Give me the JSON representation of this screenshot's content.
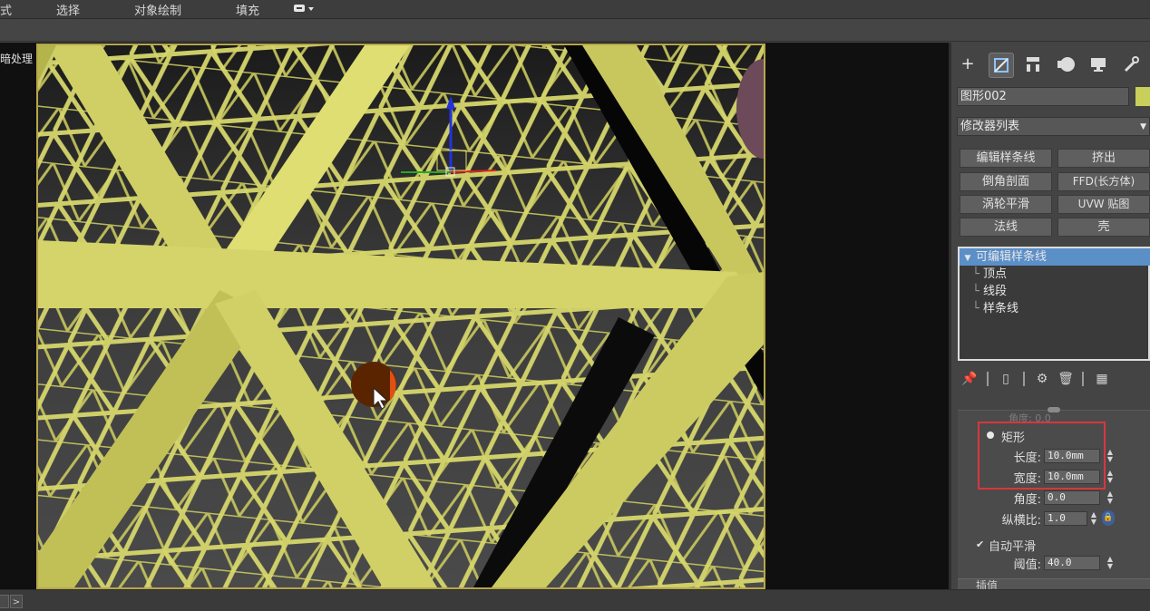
{
  "menubar": {
    "items": [
      {
        "label": "式"
      },
      {
        "label": "选择"
      },
      {
        "label": "对象绘制"
      },
      {
        "label": "填充"
      }
    ]
  },
  "viewport": {
    "label": "暗处理 ]"
  },
  "command_panel": {
    "tabs": [
      "create-icon",
      "modify-icon",
      "hierarchy-icon",
      "motion-icon",
      "display-icon",
      "utilities-icon"
    ],
    "object_name": "图形002",
    "object_color": "#c8cf5a",
    "modifier_list_label": "修改器列表",
    "modifier_buttons": [
      "编辑样条线",
      "挤出",
      "倒角剖面",
      "FFD(长方体)",
      "涡轮平滑",
      "UVW 贴图",
      "法线",
      "壳"
    ],
    "stack": {
      "root": "可编辑样条线",
      "children": [
        "顶点",
        "线段",
        "样条线"
      ]
    },
    "params": {
      "cut_label": "角度: 0.0",
      "rect_label": "矩形",
      "length_label": "长度:",
      "length_value": "10.0mm",
      "width_label": "宽度:",
      "width_value": "10.0mm",
      "angle_label": "角度:",
      "angle_value": "0.0",
      "aspect_label": "纵横比:",
      "aspect_value": "1.0",
      "auto_smooth_label": "自动平滑",
      "threshold_label": "阈值:",
      "threshold_value": "40.0",
      "next_section_label": "插值"
    }
  },
  "colors": {
    "accent_selected": "#5b8fc8",
    "highlight_box": "#d9363e",
    "mesh": "#d8d870"
  }
}
